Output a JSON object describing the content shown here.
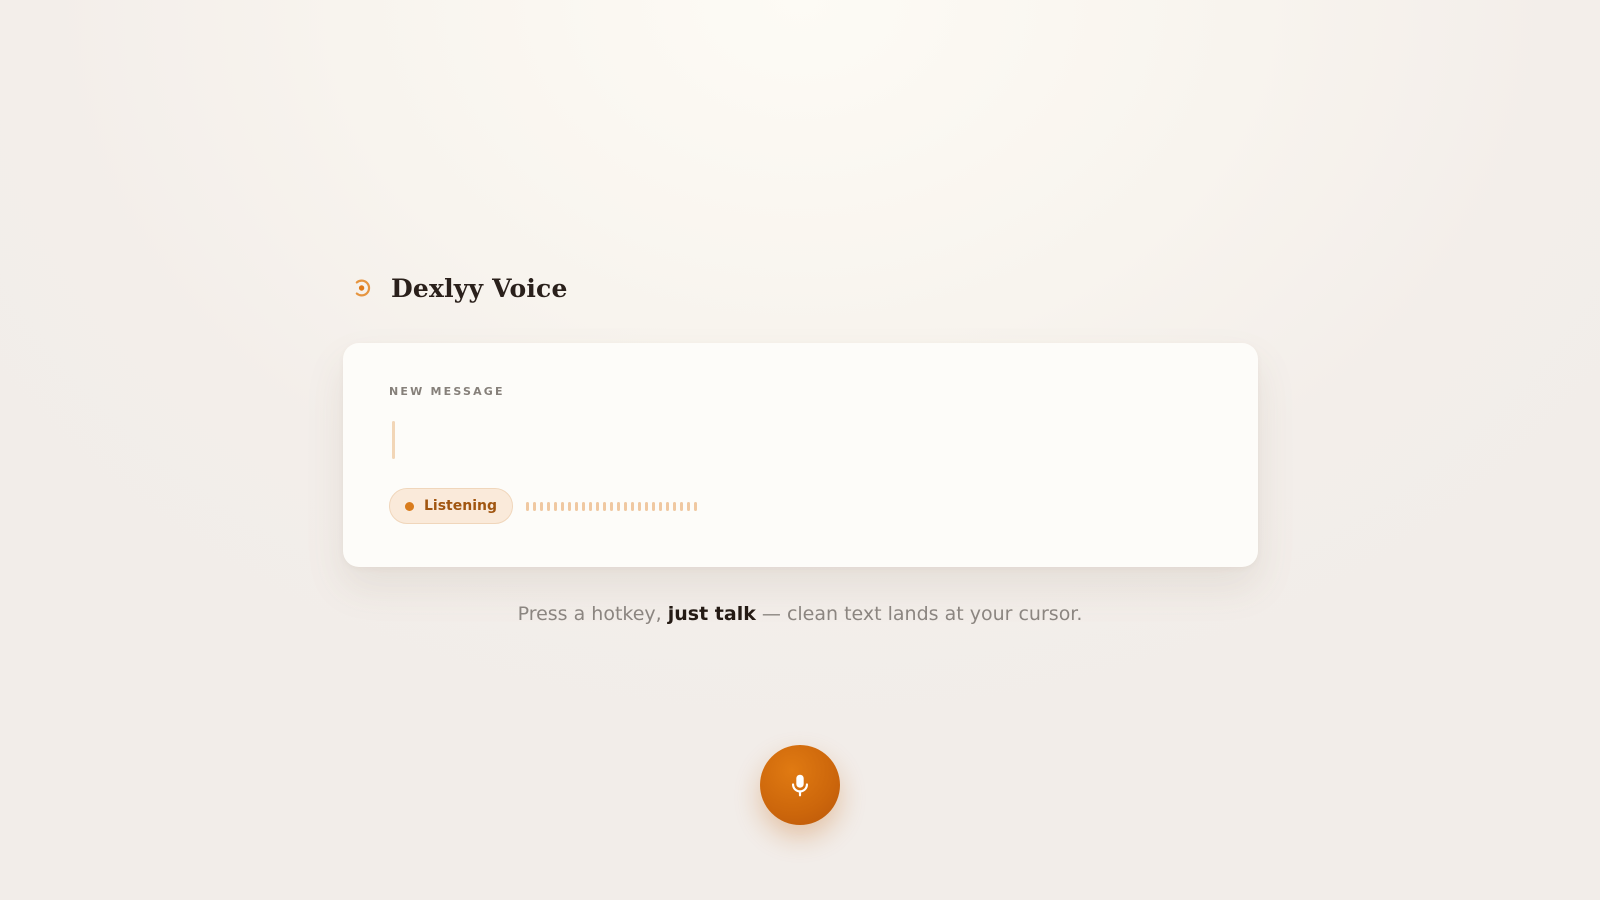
{
  "app": {
    "name": "Dexlyy Voice",
    "logo_icon": "voice-ring-icon",
    "accent_color": "#d97c1c"
  },
  "composer": {
    "label": "NEW MESSAGE",
    "value": "",
    "status": {
      "label": "Listening",
      "color": "#d97c1c"
    },
    "waveform_icon": "audio-waveform-icon"
  },
  "tagline": {
    "prefix": "Press a hotkey, ",
    "emphasis": "just talk",
    "suffix": " — clean text lands at your cursor."
  },
  "mic_button": {
    "icon": "microphone-icon",
    "color": "#d06a0e"
  }
}
